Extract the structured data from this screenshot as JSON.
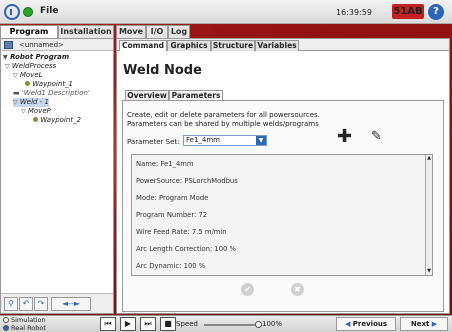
{
  "header": {
    "file_menu": "File",
    "clock": "16:39:59",
    "badge": "51AB",
    "help": "?"
  },
  "main_tabs": [
    {
      "label": "Program"
    },
    {
      "label": "Installation"
    },
    {
      "label": "Move"
    },
    {
      "label": "I/O"
    },
    {
      "label": "Log"
    }
  ],
  "left_panel": {
    "program_name": "<unnamed>",
    "tree": [
      {
        "label": "Robot Program"
      },
      {
        "label": "WeldProcess"
      },
      {
        "label": "MoveL"
      },
      {
        "label": "Waypoint_1"
      },
      {
        "label": "'Weld1 Description'"
      },
      {
        "label": "Weld - 1"
      },
      {
        "label": "MoveP"
      },
      {
        "label": "Waypoint_2"
      }
    ]
  },
  "sub_tabs": [
    {
      "label": "Command"
    },
    {
      "label": "Graphics"
    },
    {
      "label": "Structure"
    },
    {
      "label": "Variables"
    }
  ],
  "page": {
    "title": "Weld Node",
    "inner_tabs": [
      {
        "label": "Overview"
      },
      {
        "label": "Parameters"
      }
    ],
    "description_line1": "Create, edit or delete parameters for all powersources.",
    "description_line2": "Parameters can be shared by multiple welds/programs",
    "parameter_set_label": "Parameter Set:",
    "parameter_set_value": "Fe1_4mm",
    "params": [
      "Name: Fe1_4mm",
      "PowerSource: PSLorchModbus",
      "Mode: Program Mode",
      "Program Number: 72",
      "Wire Feed Rate: 7.5 m/min",
      "Arc Length Correction: 100 %",
      "Arc Dynamic: 100 %"
    ]
  },
  "bottom": {
    "simulation": "Simulation",
    "real_robot": "Real Robot",
    "speed_label": "Speed",
    "speed_value": "100%",
    "previous": "Previous",
    "next": "Next"
  },
  "colors": {
    "accent": "#2b66b8",
    "badge": "#c42020",
    "status_ok": "#2aa52a"
  }
}
